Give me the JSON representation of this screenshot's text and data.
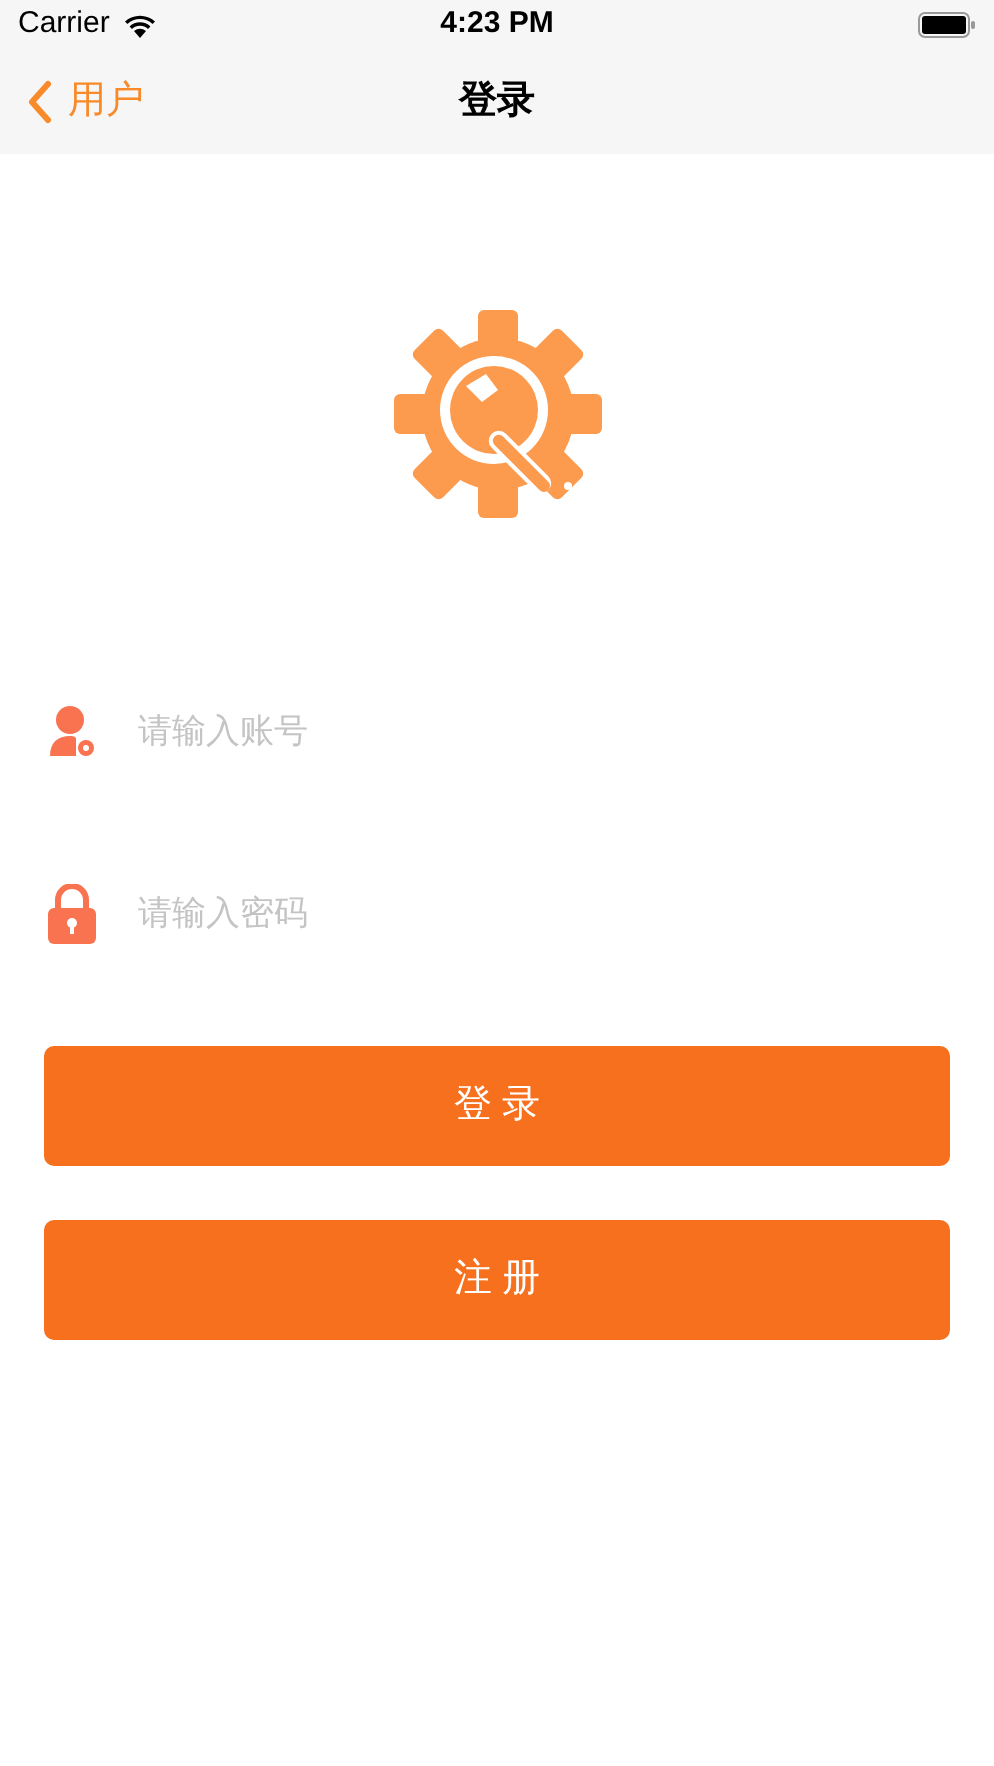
{
  "status_bar": {
    "carrier": "Carrier",
    "time": "4:23 PM"
  },
  "nav_bar": {
    "back_label": "用户",
    "title": "登录"
  },
  "fields": [
    {
      "kind": "account",
      "placeholder": "请输入账号"
    },
    {
      "kind": "password",
      "placeholder": "请输入密码"
    }
  ],
  "buttons": [
    "登 录",
    "注 册"
  ]
}
